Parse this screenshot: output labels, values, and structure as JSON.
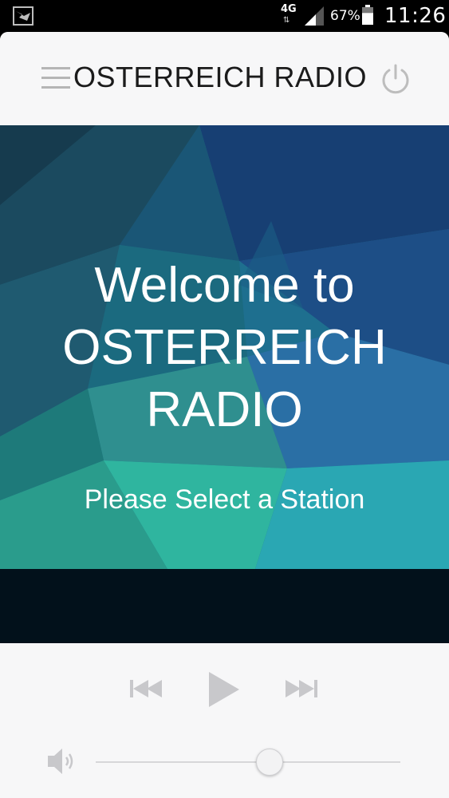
{
  "status_bar": {
    "network": "4G",
    "network_arrows": "⇅",
    "battery_percent": "67%",
    "battery_level": 0.67,
    "time": "11:26"
  },
  "header": {
    "title": "OSTERREICH RADIO",
    "menu_icon": "hamburger-menu-icon",
    "power_icon": "power-icon"
  },
  "hero": {
    "title_line1": "Welcome to",
    "title_line2": "OSTERREICH",
    "title_line3": "RADIO",
    "subtitle": "Please Select a Station"
  },
  "player": {
    "prev_icon": "skip-previous-icon",
    "play_icon": "play-icon",
    "next_icon": "skip-next-icon",
    "volume_icon": "speaker-volume-icon",
    "volume_level": 0.57
  },
  "colors": {
    "header_bg": "#f7f7f8",
    "control_icon": "#c8c8cb",
    "hero_dark": "#0d2a4a",
    "hero_teal": "#2ab5a6",
    "band_dark": "#02111b"
  }
}
